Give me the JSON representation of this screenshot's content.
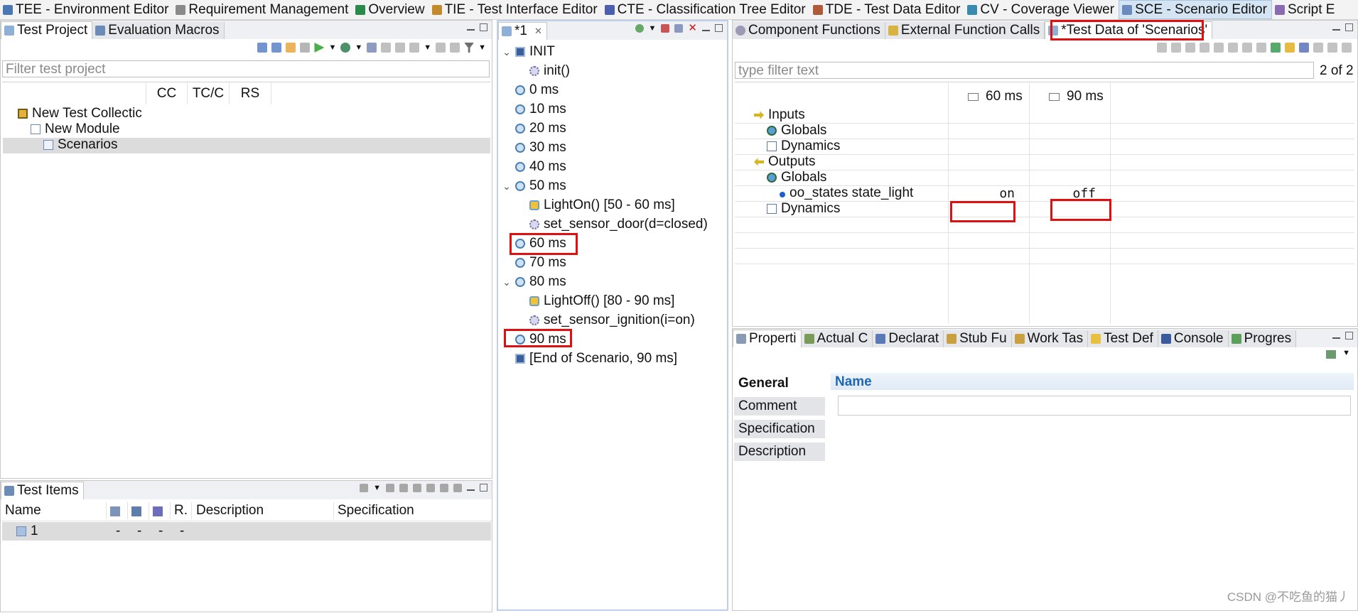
{
  "perspectives": [
    {
      "label": "TEE - Environment Editor",
      "icon": "environment-icon",
      "active": false
    },
    {
      "label": "Requirement Management",
      "icon": "requirements-icon",
      "active": false
    },
    {
      "label": "Overview",
      "icon": "globe-icon",
      "active": false
    },
    {
      "label": "TIE - Test Interface Editor",
      "icon": "interface-icon",
      "active": false
    },
    {
      "label": "CTE - Classification Tree Editor",
      "icon": "tree-icon",
      "active": false
    },
    {
      "label": "TDE - Test Data Editor",
      "icon": "data-icon",
      "active": false
    },
    {
      "label": "CV - Coverage Viewer",
      "icon": "coverage-icon",
      "active": false
    },
    {
      "label": "SCE - Scenario Editor",
      "icon": "scenario-icon",
      "active": true
    },
    {
      "label": "Script E",
      "icon": "script-icon",
      "active": false
    }
  ],
  "test_project": {
    "tabs": [
      {
        "label": "Test Project"
      },
      {
        "label": "Evaluation Macros"
      }
    ],
    "filter_placeholder": "Filter test project",
    "columns": [
      "CC",
      "TC/C",
      "RS"
    ],
    "tree": [
      {
        "label": "New Test Collectic",
        "indent": 0
      },
      {
        "label": "New Module",
        "indent": 1
      },
      {
        "label": "Scenarios",
        "indent": 2,
        "selected": true
      }
    ]
  },
  "test_items": {
    "tab": "Test Items",
    "columns": [
      "Name",
      "R.",
      "Description",
      "Specification"
    ],
    "rows": [
      {
        "name": "1",
        "c1": "-",
        "c2": "-",
        "c3": "-",
        "c4": "-"
      }
    ]
  },
  "scenario": {
    "tab": "*1",
    "items": [
      {
        "label": "INIT",
        "kind": "square",
        "chev": "⌄",
        "indent": 0
      },
      {
        "label": "init()",
        "kind": "gear",
        "chev": "",
        "indent": 1
      },
      {
        "label": "0 ms",
        "kind": "clock",
        "chev": "",
        "indent": 0
      },
      {
        "label": "10 ms",
        "kind": "clock",
        "chev": "",
        "indent": 0
      },
      {
        "label": "20 ms",
        "kind": "clock",
        "chev": "",
        "indent": 0
      },
      {
        "label": "30 ms",
        "kind": "clock",
        "chev": "",
        "indent": 0
      },
      {
        "label": "40 ms",
        "kind": "clock",
        "chev": "",
        "indent": 0
      },
      {
        "label": "50 ms",
        "kind": "clock",
        "chev": "⌄",
        "indent": 0
      },
      {
        "label": "LightOn() [50 - 60 ms]",
        "kind": "fn",
        "chev": "",
        "indent": 1
      },
      {
        "label": "set_sensor_door(d=closed)",
        "kind": "gear",
        "chev": "",
        "indent": 1
      },
      {
        "label": "60 ms",
        "kind": "clock",
        "chev": "",
        "indent": 0
      },
      {
        "label": "70 ms",
        "kind": "clock",
        "chev": "",
        "indent": 0
      },
      {
        "label": "80 ms",
        "kind": "clock",
        "chev": "⌄",
        "indent": 0
      },
      {
        "label": "LightOff() [80 - 90 ms]",
        "kind": "fn",
        "chev": "",
        "indent": 1
      },
      {
        "label": "set_sensor_ignition(i=on)",
        "kind": "gear",
        "chev": "",
        "indent": 1
      },
      {
        "label": "90 ms",
        "kind": "clock",
        "chev": "",
        "indent": 0
      },
      {
        "label": "[End of Scenario, 90 ms]",
        "kind": "endsq",
        "chev": "",
        "indent": 0
      }
    ]
  },
  "test_data": {
    "tabs": [
      {
        "label": "Component Functions"
      },
      {
        "label": "External Function Calls"
      },
      {
        "label": "*Test Data of 'Scenarios'"
      }
    ],
    "filter_placeholder": "type filter text",
    "page_count": "2 of 2",
    "columns": [
      "60 ms",
      "90 ms"
    ],
    "rows": [
      {
        "label": "Inputs",
        "indent": 0,
        "icon": "arrow-in-icon",
        "v1": "",
        "v2": ""
      },
      {
        "label": "Globals",
        "indent": 1,
        "icon": "globals-icon",
        "v1": "",
        "v2": ""
      },
      {
        "label": "Dynamics",
        "indent": 1,
        "icon": "dynamics-icon",
        "v1": "",
        "v2": ""
      },
      {
        "label": "Outputs",
        "indent": 0,
        "icon": "arrow-out-icon",
        "v1": "",
        "v2": ""
      },
      {
        "label": "Globals",
        "indent": 1,
        "icon": "globals-icon",
        "v1": "",
        "v2": ""
      },
      {
        "label": "oo_states state_light",
        "indent": 2,
        "icon": "variable-dot-icon",
        "v1": "on",
        "v2": "off"
      },
      {
        "label": "Dynamics",
        "indent": 1,
        "icon": "dynamics-icon",
        "v1": "",
        "v2": ""
      }
    ]
  },
  "properties": {
    "tabs": [
      "Properti",
      "Actual C",
      "Declarat",
      "Stub Fu",
      "Work Tas",
      "Test Def",
      "Console",
      "Progres"
    ],
    "categories": [
      "General",
      "Comment",
      "Specification",
      "Description"
    ],
    "name_label": "Name",
    "name_value": ""
  },
  "watermark": "CSDN @不吃鱼的猫丿",
  "colors": {
    "accent": "#1f66b3",
    "highlight": "#e01010",
    "selected_row": "#dcdcdc",
    "tabbar": "#eef0f3"
  }
}
